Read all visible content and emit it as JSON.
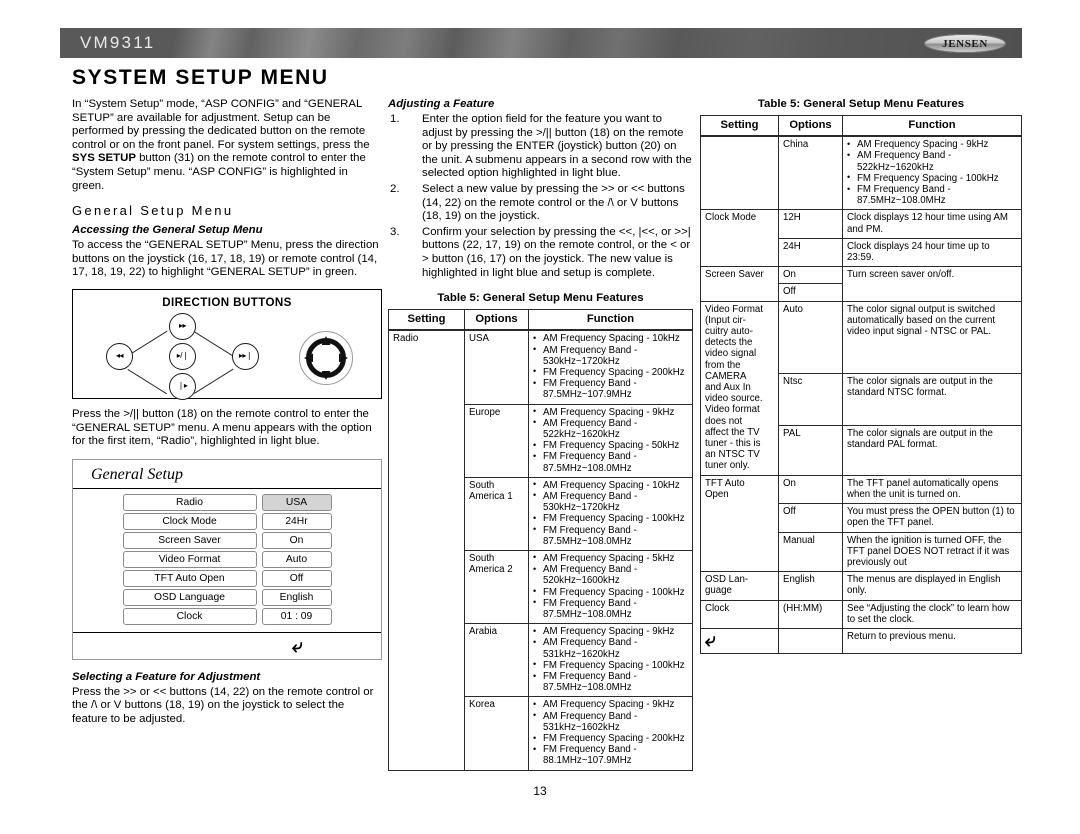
{
  "header": {
    "model": "VM9311",
    "brand": "JENSEN"
  },
  "page_title": "SYSTEM SETUP MENU",
  "page_number": "13",
  "column1": {
    "intro_paragraph": "In “System Setup” mode, “ASP CONFIG” and “GENERAL SETUP” are available for adjustment. Setup can be performed by pressing the dedicated button on the remote control or on the front panel. For system settings, press the SYS SETUP button (31) on the remote control to enter the “System Setup” menu. “ASP CONFIG” is highlighted in green.",
    "intro_part1": "In “System Setup” mode, “ASP CONFIG” and “GENERAL SETUP” are available for adjustment. Setup can be performed by pressing the dedicated button on the remote control or on the front panel. For system settings, press the ",
    "intro_bold": "SYS SETUP",
    "intro_part2": " button (31) on the remote control to enter the “System Setup” menu. “ASP CONFIG” is highlighted in green.",
    "section_heading": "General Setup Menu",
    "sub1_heading": "Accessing the General Setup Menu",
    "sub1_body": "To access the “GENERAL SETUP” Menu, press the direction buttons on the joystick (16, 17, 18, 19) or remote control (14, 17, 18, 19, 22) to highlight “GENERAL SETUP” in green.",
    "direction_box": {
      "title": "DIRECTION BUTTONS",
      "buttons": {
        "up": "▸▸",
        "left": "◂◂",
        "center": "▸/❘",
        "right": "▸▸❘",
        "down": "❘▸"
      },
      "joystick_name": "joystick-ring"
    },
    "after_box_body_part1": "Press the >/|| button (18) on the remote control to enter the “GENERAL SETUP” menu. A menu appears with the option for the first item, “Radio”, highlighted in light blue.",
    "osd": {
      "title": "General Setup",
      "rows": [
        {
          "label": "Radio",
          "value": "USA",
          "selected": true
        },
        {
          "label": "Clock  Mode",
          "value": "24Hr",
          "selected": false
        },
        {
          "label": "Screen Saver",
          "value": "On",
          "selected": false
        },
        {
          "label": "Video Format",
          "value": "Auto",
          "selected": false
        },
        {
          "label": "TFT Auto Open",
          "value": "Off",
          "selected": false
        },
        {
          "label": "OSD Language",
          "value": "English",
          "selected": false
        },
        {
          "label": "Clock",
          "value": "01 :  09",
          "selected": false
        }
      ]
    },
    "sub2_heading": "Selecting a Feature for Adjustment",
    "sub2_body": "Press the >> or << buttons (14, 22) on the remote control or the /\\ or V buttons (18, 19) on the joystick to select the feature to be adjusted."
  },
  "column2": {
    "sub_heading": "Adjusting a Feature",
    "steps": [
      {
        "num": "1.",
        "text": "Enter the option field for the feature you want to adjust by pressing the >/|| button (18) on the remote or by pressing the ENTER (joystick) button (20) on the unit. A submenu appears in a second row with the selected option highlighted in light blue."
      },
      {
        "num": "2.",
        "text": "Select a new value by pressing the >> or << buttons (14, 22) on the remote control or the /\\ or V buttons (18, 19) on the joystick."
      },
      {
        "num": "3.",
        "text": "Confirm your selection by pressing the <<, |<<, or >>| buttons (22, 17, 19) on the remote control, or the < or > button (16, 17) on the joystick. The new value is highlighted in light blue and setup is complete."
      }
    ],
    "table": {
      "caption": "Table 5: General Setup Menu Features",
      "headers": [
        "Setting",
        "Options",
        "Function"
      ],
      "rows": [
        {
          "setting": "Radio",
          "setting_rowspan": 6,
          "option": "USA",
          "bullets": [
            "AM Frequency Spacing - 10kHz",
            "AM Frequency Band - 530kHz~1720kHz",
            "FM Frequency Spacing - 200kHz",
            "FM Frequency Band - 87.5MHz~107.9MHz"
          ]
        },
        {
          "setting": "",
          "option": "Europe",
          "bullets": [
            "AM Frequency Spacing - 9kHz",
            "AM Frequency Band - 522kHz~1620kHz",
            "FM Frequency Spacing - 50kHz",
            "FM Frequency Band - 87.5MHz~108.0MHz"
          ]
        },
        {
          "setting": "",
          "option": "South\nAmerica 1",
          "bullets": [
            "AM Frequency Spacing - 10kHz",
            "AM Frequency Band - 530kHz~1720kHz",
            "FM Frequency Spacing - 100kHz",
            "FM Frequency Band - 87.5MHz~108.0MHz"
          ]
        },
        {
          "setting": "",
          "option": "South\nAmerica 2",
          "bullets": [
            "AM Frequency Spacing - 5kHz",
            "AM Frequency Band - 520kHz~1600kHz",
            "FM Frequency Spacing - 100kHz",
            "FM Frequency Band - 87.5MHz~108.0MHz"
          ]
        },
        {
          "setting": "",
          "option": "Arabia",
          "bullets": [
            "AM Frequency Spacing - 9kHz",
            "AM Frequency Band - 531kHz~1620kHz",
            "FM Frequency Spacing - 100kHz",
            "FM Frequency Band - 87.5MHz~108.0MHz"
          ]
        },
        {
          "setting": "",
          "option": "Korea",
          "bullets": [
            "AM Frequency Spacing - 9kHz",
            "AM Frequency Band - 531kHz~1602kHz",
            "FM Frequency Spacing - 200kHz",
            "FM Frequency Band - 88.1MHz~107.9MHz"
          ]
        }
      ]
    }
  },
  "column3": {
    "table": {
      "caption": "Table 5: General Setup Menu Features",
      "headers": [
        "Setting",
        "Options",
        "Function"
      ],
      "rows": [
        {
          "setting": "",
          "option": "China",
          "bullets": [
            "AM Frequency Spacing - 9kHz",
            "AM Frequency Band - 522kHz~1620kHz",
            "FM Frequency Spacing - 100kHz",
            "FM Frequency Band - 87.5MHz~108.0MHz"
          ],
          "function": ""
        },
        {
          "setting": "Clock Mode",
          "option": "12H",
          "function": "Clock displays 12 hour time using AM and PM."
        },
        {
          "setting": "",
          "option": "24H",
          "function": "Clock displays 24 hour time up to 23:59."
        },
        {
          "setting": "Screen Saver",
          "option": "On",
          "function": "Turn screen saver on/off."
        },
        {
          "setting": "",
          "option": "Off",
          "function": ""
        },
        {
          "setting": "Video Format\n(Input cir-\ncuitry auto-\ndetects the\nvideo signal\nfrom the\nCAMERA\nand Aux In\nvideo source.\nVideo format\ndoes not\naffect the TV\ntuner - this is\nan NTSC TV\ntuner only.",
          "option": "Auto",
          "function": "The color signal output is switched automatically based on the current video input signal - NTSC or PAL."
        },
        {
          "setting": "",
          "option": "Ntsc",
          "function": "The color signals are output in the standard NTSC format."
        },
        {
          "setting": "",
          "option": "PAL",
          "function": "The color signals are output in the standard PAL format."
        },
        {
          "setting": "TFT Auto\nOpen",
          "option": "On",
          "function": "The TFT panel automatically opens when the unit is turned on."
        },
        {
          "setting": "",
          "option": "Off",
          "function": "You must press the OPEN button (1) to open the TFT panel."
        },
        {
          "setting": "",
          "option": "Manual",
          "function": "When the ignition is turned OFF, the TFT panel DOES NOT retract if it was previously out"
        },
        {
          "setting": "OSD Lan-\nguage",
          "option": "English",
          "function": "The menus are displayed in English only."
        },
        {
          "setting": "Clock",
          "option": "(HH:MM)",
          "function": "See “Adjusting the clock” to learn how to set the clock."
        },
        {
          "setting": "↩",
          "option": "",
          "function": "Return to previous menu."
        }
      ]
    }
  }
}
